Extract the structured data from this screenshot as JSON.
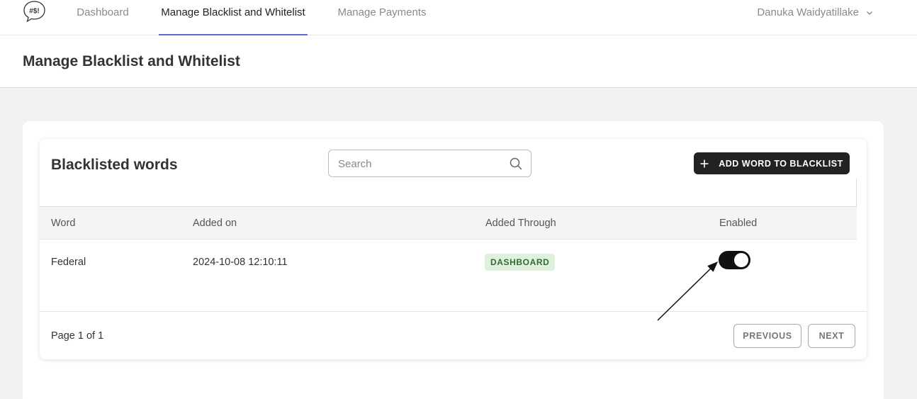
{
  "nav": {
    "logo_text": "#$!",
    "tabs": [
      {
        "label": "Dashboard"
      },
      {
        "label": "Manage Blacklist and Whitelist"
      },
      {
        "label": "Manage Payments"
      }
    ],
    "user_name": "Danuka Waidyatillake"
  },
  "page": {
    "title": "Manage Blacklist and Whitelist"
  },
  "card": {
    "title": "Blacklisted words",
    "search_placeholder": "Search",
    "add_button_label": "ADD WORD TO BLACKLIST"
  },
  "table": {
    "columns": [
      "Word",
      "Added on",
      "Added Through",
      "Enabled"
    ],
    "rows": [
      {
        "word": "Federal",
        "added_on": "2024-10-08 12:10:11",
        "added_through": "DASHBOARD",
        "enabled": true
      }
    ]
  },
  "pagination": {
    "info": "Page 1 of 1",
    "previous_label": "PREVIOUS",
    "next_label": "NEXT"
  },
  "colors": {
    "accent_underline": "#5b6bd4",
    "badge_bg": "#dff0dc",
    "badge_text": "#2e6d32",
    "toggle_on": "#111111"
  }
}
